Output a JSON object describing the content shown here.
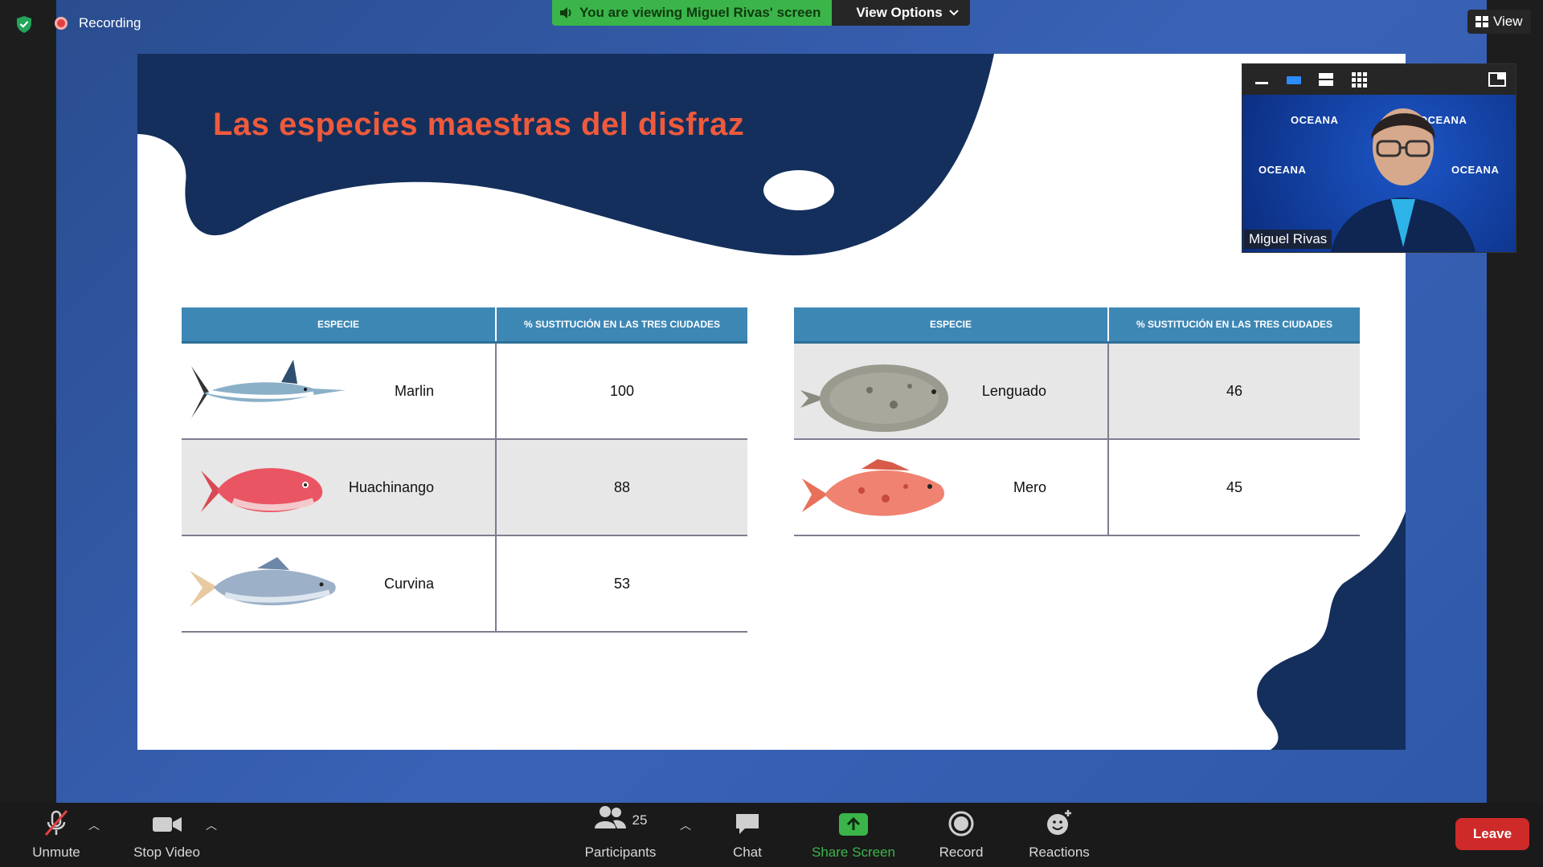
{
  "top": {
    "recording_label": "Recording",
    "banner_text": "You are viewing Miguel Rivas' screen",
    "view_options_label": "View Options",
    "view_label": "View"
  },
  "slide": {
    "title": "Las especies maestras del disfraz",
    "table_left": {
      "col_species": "ESPECIE",
      "col_pct": "% SUSTITUCIÓN EN LAS TRES CIUDADES",
      "rows": [
        {
          "species": "Marlin",
          "pct": "100"
        },
        {
          "species": "Huachinango",
          "pct": "88"
        },
        {
          "species": "Curvina",
          "pct": "53"
        }
      ]
    },
    "table_right": {
      "col_species": "ESPECIE",
      "col_pct": "% SUSTITUCIÓN EN LAS TRES CIUDADES",
      "rows": [
        {
          "species": "Lenguado",
          "pct": "46"
        },
        {
          "species": "Mero",
          "pct": "45"
        }
      ]
    }
  },
  "pip": {
    "name": "Miguel Rivas",
    "brand_text": "OCEANA"
  },
  "toolbar": {
    "unmute": "Unmute",
    "stop_video": "Stop Video",
    "participants": "Participants",
    "participants_count": "25",
    "chat": "Chat",
    "share_screen": "Share Screen",
    "record": "Record",
    "reactions": "Reactions",
    "leave": "Leave"
  },
  "colors": {
    "accent_green": "#3bb54a",
    "leave_red": "#cf2a2a",
    "title_orange": "#ef5a3c",
    "table_header": "#3d87b5",
    "slide_navy": "#142f5c"
  }
}
